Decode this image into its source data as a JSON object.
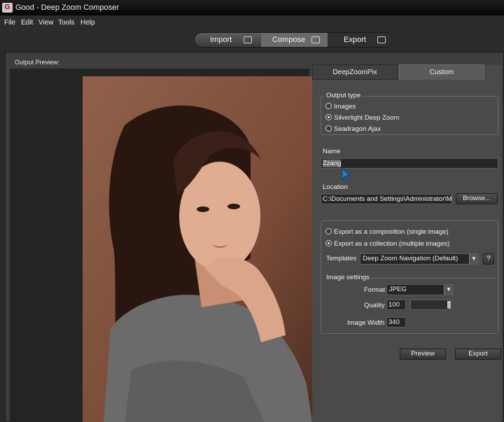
{
  "window": {
    "title": "Good - Deep Zoom Composer",
    "logo_glyph": "G"
  },
  "menu": [
    "File",
    "Edit",
    "View",
    "Tools",
    "Help"
  ],
  "modes": [
    {
      "label": "Import",
      "icon": "import-icon"
    },
    {
      "label": "Compose",
      "icon": "compose-icon"
    },
    {
      "label": "Export",
      "icon": "export-icon"
    }
  ],
  "preview": {
    "label": "Output Preview:"
  },
  "tabs": [
    {
      "label": "DeepZoomPix",
      "active": false
    },
    {
      "label": "Custom",
      "active": true
    }
  ],
  "output_type": {
    "legend": "Output type",
    "options": [
      {
        "label": "Images",
        "selected": false
      },
      {
        "label": "Silverlight Deep Zoom",
        "selected": true
      },
      {
        "label": "Seadragon Ajax",
        "selected": false
      }
    ]
  },
  "name": {
    "label": "Name",
    "value": "Zzang"
  },
  "location": {
    "label": "Location",
    "value": "C:\\Documents and Settings\\Administrator\\My",
    "browse_label": "Browse..."
  },
  "export_mode": {
    "options": [
      {
        "label": "Export as a composition (single image)",
        "selected": false
      },
      {
        "label": "Export as a collection (multiple images)",
        "selected": true
      }
    ],
    "templates_label": "Templates",
    "template_value": "Deep Zoom Navigation (Default)",
    "help_label": "?"
  },
  "image_settings": {
    "heading": "Image settings",
    "format_label": "Format",
    "format_value": "JPEG",
    "quality_label": "Quality",
    "quality_value": "100",
    "quality_level": 1.0,
    "width_label": "Image Width",
    "width_value": "340"
  },
  "actions": {
    "preview_label": "Preview",
    "export_label": "Export"
  },
  "colors": {
    "panel": "#4a4a4a",
    "background": "#2a2a2a",
    "accent": "#5a5a5a"
  }
}
